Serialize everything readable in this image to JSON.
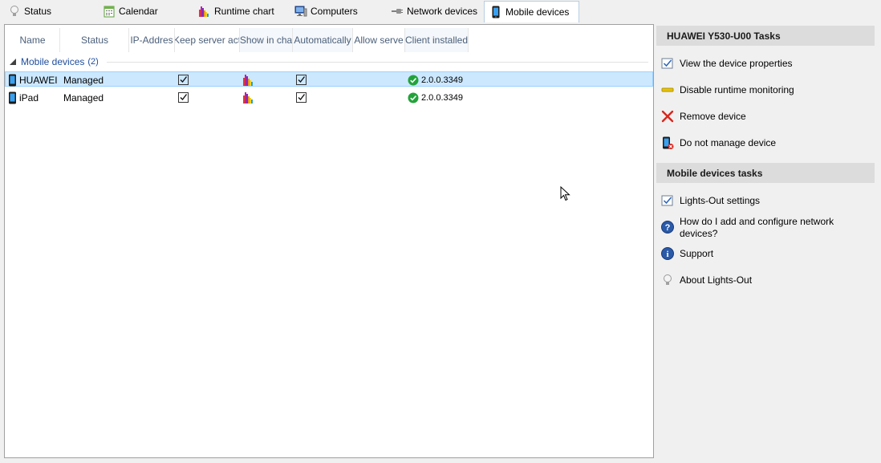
{
  "tabs": [
    {
      "label": "Status",
      "icon": "bulb-icon"
    },
    {
      "label": "Calendar",
      "icon": "calendar-icon"
    },
    {
      "label": "Runtime chart",
      "icon": "chart-icon"
    },
    {
      "label": "Computers",
      "icon": "computer-icon"
    },
    {
      "label": "Network devices",
      "icon": "network-plug-icon"
    },
    {
      "label": "Mobile devices",
      "icon": "mobile-icon",
      "active": true
    }
  ],
  "columns": [
    "Name",
    "Status",
    "IP-Addres",
    "Keep server act",
    "Show in cha",
    "Automatically",
    "Allow serve",
    "Client installed"
  ],
  "group": {
    "label": "Mobile devices",
    "count": "(2)"
  },
  "rows": [
    {
      "name": "HUAWEI",
      "status": "Managed",
      "keep_server": true,
      "show_chart": true,
      "automatically": true,
      "client_version": "2.0.0.3349",
      "selected": true
    },
    {
      "name": "iPad",
      "status": "Managed",
      "keep_server": true,
      "show_chart": true,
      "automatically": true,
      "client_version": "2.0.0.3349",
      "selected": false
    }
  ],
  "device_tasks": {
    "title": "HUAWEI Y530-U00 Tasks",
    "items": [
      {
        "label": "View the device properties",
        "icon": "properties-checkbox-icon"
      },
      {
        "label": "Disable runtime monitoring",
        "icon": "yellow-bar-icon"
      },
      {
        "label": "Remove device",
        "icon": "red-x-icon"
      },
      {
        "label": "Do not manage device",
        "icon": "unmanage-phone-icon"
      }
    ]
  },
  "mobile_tasks": {
    "title": "Mobile devices tasks",
    "items": [
      {
        "label": "Lights-Out settings",
        "icon": "settings-checkbox-icon"
      },
      {
        "label": "How do I add and configure network devices?",
        "icon": "help-icon"
      },
      {
        "label": "Support",
        "icon": "info-icon"
      },
      {
        "label": "About Lights-Out",
        "icon": "bulb-icon"
      }
    ]
  },
  "colors": {
    "accent": "#1f4e9c",
    "selection": "#cce8ff",
    "ok_green": "#22a33a",
    "remove_red": "#d9261c"
  }
}
